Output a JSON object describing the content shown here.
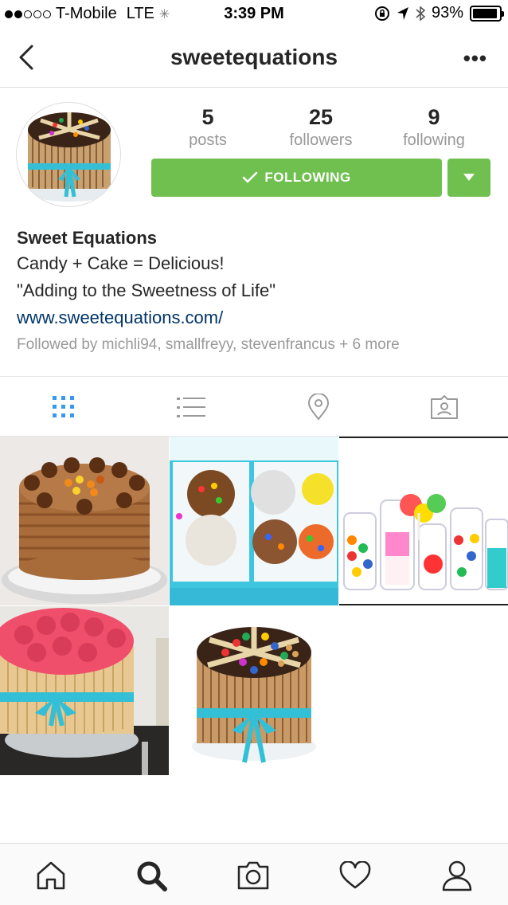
{
  "status_bar": {
    "signal_dots_filled": 2,
    "signal_dots_total": 5,
    "carrier": "T-Mobile",
    "network": "LTE",
    "time": "3:39 PM",
    "battery": "93%",
    "battery_level": 0.93
  },
  "header": {
    "title": "sweetequations",
    "back_icon": "chevron-left-icon",
    "more_icon": "more-dots-icon",
    "more_glyph": "•••"
  },
  "profile": {
    "stats": [
      {
        "value": "5",
        "label": "posts"
      },
      {
        "value": "25",
        "label": "followers"
      },
      {
        "value": "9",
        "label": "following"
      }
    ],
    "follow_button_label": "FOLLOWING",
    "follow_button_color": "#70c050",
    "display_name": "Sweet Equations",
    "bio_lines": [
      "Candy + Cake = Delicious!",
      "\"Adding to the Sweetness of Life\""
    ],
    "website": "www.sweetequations.com/",
    "followed_by": "Followed by michli94, smallfreyy, stevenfrancus + 6 more"
  },
  "view_tabs": [
    {
      "name": "grid-view",
      "icon": "grid-icon",
      "active": true
    },
    {
      "name": "list-view",
      "icon": "list-icon",
      "active": false
    },
    {
      "name": "location-view",
      "icon": "location-pin-icon",
      "active": false
    },
    {
      "name": "tagged-view",
      "icon": "tagged-photo-icon",
      "active": false
    }
  ],
  "posts": [
    {
      "name": "post-chocolate-cake",
      "desc_icon": "chocolate-cake-image"
    },
    {
      "name": "post-candy-boxes",
      "desc_icon": "candy-boxes-image"
    },
    {
      "name": "post-candy-jars",
      "desc_icon": "candy-jars-image"
    },
    {
      "name": "post-pink-rose-cake",
      "desc_icon": "pink-rose-cake-image"
    },
    {
      "name": "post-candy-pirouline-cake",
      "desc_icon": "candy-cake-image"
    }
  ],
  "bottom_nav": [
    {
      "name": "home",
      "icon": "home-icon"
    },
    {
      "name": "search",
      "icon": "search-icon",
      "active": true
    },
    {
      "name": "camera",
      "icon": "camera-icon"
    },
    {
      "name": "activity",
      "icon": "heart-icon"
    },
    {
      "name": "profile",
      "icon": "profile-icon"
    }
  ],
  "colors": {
    "accent_blue": "#3897f0",
    "link_blue": "#003569",
    "muted_gray": "#999999"
  }
}
